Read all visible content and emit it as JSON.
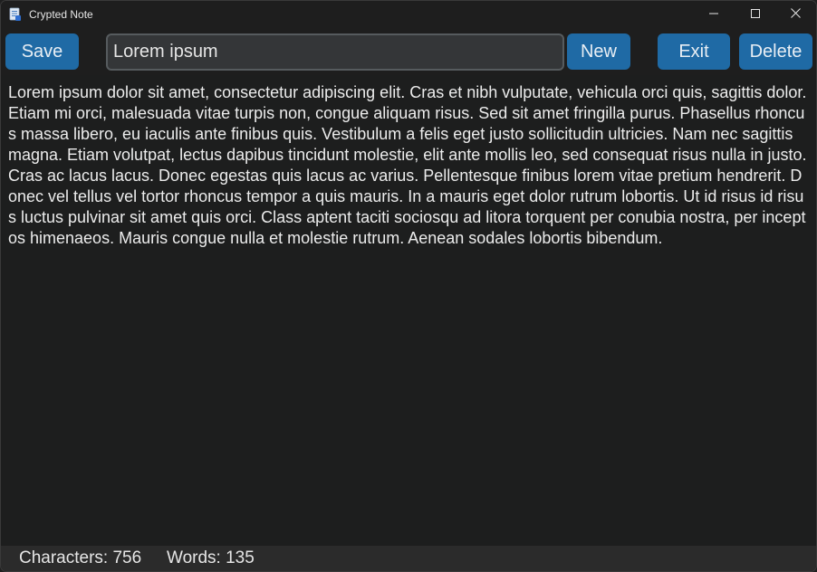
{
  "window": {
    "title": "Crypted Note"
  },
  "toolbar": {
    "save_label": "Save",
    "title_value": "Lorem ipsum",
    "new_label": "New",
    "exit_label": "Exit",
    "delete_label": "Delete"
  },
  "note": {
    "body": "Lorem ipsum dolor sit amet, consectetur adipiscing elit. Cras et nibh vulputate, vehicula orci quis, sagittis dolor. Etiam mi orci, malesuada vitae turpis non, congue aliquam risus. Sed sit amet fringilla purus. Phasellus rhoncus massa libero, eu iaculis ante finibus quis. Vestibulum a felis eget justo sollicitudin ultricies. Nam nec sagittis magna. Etiam volutpat, lectus dapibus tincidunt molestie, elit ante mollis leo, sed consequat risus nulla in justo. Cras ac lacus lacus. Donec egestas quis lacus ac varius. Pellentesque finibus lorem vitae pretium hendrerit. Donec vel tellus vel tortor rhoncus tempor a quis mauris. In a mauris eget dolor rutrum lobortis. Ut id risus id risus luctus pulvinar sit amet quis orci. Class aptent taciti sociosqu ad litora torquent per conubia nostra, per inceptos himenaeos. Mauris congue nulla et molestie rutrum. Aenean sodales lobortis bibendum."
  },
  "status": {
    "characters": "Characters: 756",
    "words": "Words: 135"
  },
  "icons": {
    "app": "notepad-icon",
    "minimize": "minimize-icon",
    "maximize": "maximize-icon",
    "close": "close-icon"
  },
  "colors": {
    "accent": "#1f6aa5",
    "background": "#1e1e1e",
    "input_background": "#343638",
    "statusbar_background": "#2b2b2b"
  }
}
